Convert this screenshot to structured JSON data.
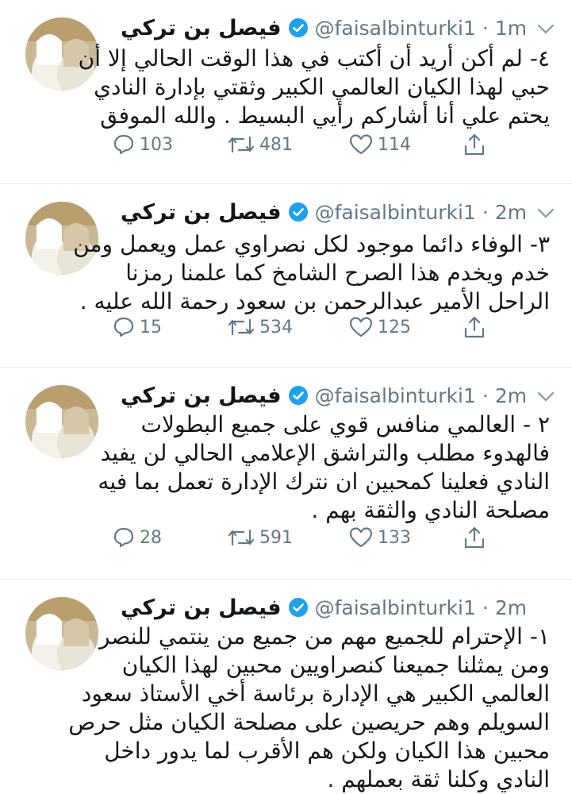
{
  "tweets": [
    {
      "name": "فيصل بن تركي",
      "handle": "@faisalbinturki1",
      "sep": "·",
      "time": "1m",
      "lines": [
        "٤- لم أكن أريد أن أكتب في هذا الوقت الحالي إلا أن",
        "حبي لهذا الكيان العالمي الكبير وثقتي بإدارة النادي",
        "يحتم علي أنا أشاركم رأيي البسيط . والله الموفق"
      ],
      "replies": "103",
      "retweets": "481",
      "likes": "114"
    },
    {
      "name": "فيصل بن تركي",
      "handle": "@faisalbinturki1",
      "sep": "·",
      "time": "2m",
      "lines": [
        "٣- الوفاء دائما موجود لكل نصراوي عمل ويعمل ومن",
        "خدم ويخدم هذا الصرح الشامخ كما علمنا رمزنا",
        "الراحل الأمير عبدالرحمن بن سعود رحمة الله عليه ."
      ],
      "replies": "15",
      "retweets": "534",
      "likes": "125"
    },
    {
      "name": "فيصل بن تركي",
      "handle": "@faisalbinturki1",
      "sep": "·",
      "time": "2m",
      "lines": [
        "٢ - العالمي منافس قوي على جميع البطولات",
        "فالهدوء مطلب والتراشق الإعلامي الحالي لن يفيد",
        "النادي فعلينا كمحبين ان نترك الإدارة تعمل بما فيه",
        "مصلحة النادي والثقة بهم ."
      ],
      "replies": "28",
      "retweets": "591",
      "likes": "133"
    },
    {
      "name": "فيصل بن تركي",
      "handle": "@faisalbinturki1",
      "sep": "·",
      "time": "2m",
      "lines": [
        "١- الإحترام للجميع مهم من جميع من ينتمي للنصر",
        "ومن يمثلنا جميعنا كنصراويين محبين لهذا الكيان",
        "العالمي الكبير هي الإدارة برئاسة أخي الأستاذ سعود",
        "السويلم وهم حريصين على مصلحة الكيان مثل حرص",
        "محبين هذا الكيان ولكن هم الأقرب لما يدور داخل",
        "النادي وكلنا ثقة بعملهم ."
      ],
      "replies": "",
      "retweets": "",
      "likes": ""
    }
  ],
  "icons": {
    "reply": "reply-icon",
    "retweet": "retweet-icon",
    "like": "heart-icon",
    "share": "share-icon",
    "verified": "verified-badge-icon",
    "caret": "chevron-down-icon"
  },
  "colors": {
    "text": "#14171a",
    "muted": "#657786",
    "verified": "#1da1f2",
    "divider": "#e6ecf0"
  }
}
